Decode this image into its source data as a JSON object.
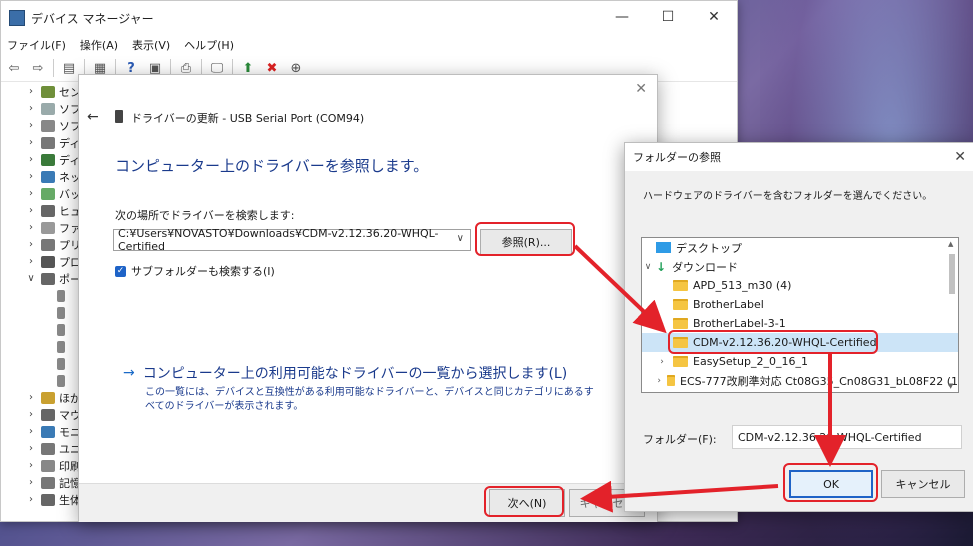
{
  "devmgr": {
    "title": "デバイス マネージャー",
    "menu": [
      "ファイル(F)",
      "操作(A)",
      "表示(V)",
      "ヘルプ(H)"
    ],
    "tree": [
      "セン",
      "ソフ",
      "ソフ",
      "ディ",
      "ディ",
      "ネッ",
      "バッ",
      "ヒュ",
      "ファ",
      "プリ",
      "プロ",
      "ポー",
      "",
      "",
      "",
      "",
      "",
      "",
      "ほか",
      "マウ",
      "モニ",
      "ユニ",
      "印刷",
      "記憶",
      "生体"
    ]
  },
  "driver_dialog": {
    "title": "ドライバーの更新 - USB Serial Port (COM94)",
    "heading": "コンピューター上のドライバーを参照します。",
    "search_label": "次の場所でドライバーを検索します:",
    "path_value": "C:¥Users¥NOVASTO¥Downloads¥CDM-v2.12.36.20-WHQL-Certified",
    "browse_label": "参照(R)...",
    "include_subfolders_label": "サブフォルダーも検索する(I)",
    "pick_link": "コンピューター上の利用可能なドライバーの一覧から選択します(L)",
    "pick_desc": "この一覧には、デバイスと互換性がある利用可能なドライバーと、デバイスと同じカテゴリにあるすべてのドライバーが表示されます。",
    "next_label": "次へ(N)",
    "cancel_label": "キャンセル"
  },
  "folder_dialog": {
    "title": "フォルダーの参照",
    "description": "ハードウェアのドライバーを含むフォルダーを選んでください。",
    "items": [
      {
        "label": "デスクトップ",
        "kind": "desktop",
        "chev": "",
        "indent": 0
      },
      {
        "label": "ダウンロード",
        "kind": "download",
        "chev": "∨",
        "indent": 0
      },
      {
        "label": "APD_513_m30 (4)",
        "kind": "folder",
        "chev": "",
        "indent": 1
      },
      {
        "label": "BrotherLabel",
        "kind": "folder",
        "chev": "",
        "indent": 1
      },
      {
        "label": "BrotherLabel-3-1",
        "kind": "folder",
        "chev": "›",
        "indent": 1
      },
      {
        "label": "CDM-v2.12.36.20-WHQL-Certified",
        "kind": "folder",
        "chev": "",
        "indent": 1,
        "selected": true
      },
      {
        "label": "EasySetup_2_0_16_1",
        "kind": "folder",
        "chev": "›",
        "indent": 1
      },
      {
        "label": "ECS-777改刷準対応 Ct08G35_Cn08G31_bL08F22 (1",
        "kind": "folder",
        "chev": "›",
        "indent": 1
      }
    ],
    "folder_label": "フォルダー(F):",
    "folder_value": "CDM-v2.12.36.20-WHQL-Certified",
    "ok_label": "OK",
    "cancel_label": "キャンセル"
  },
  "colors": {
    "annotation": "#e3222a",
    "link": "#1a3a8c"
  }
}
